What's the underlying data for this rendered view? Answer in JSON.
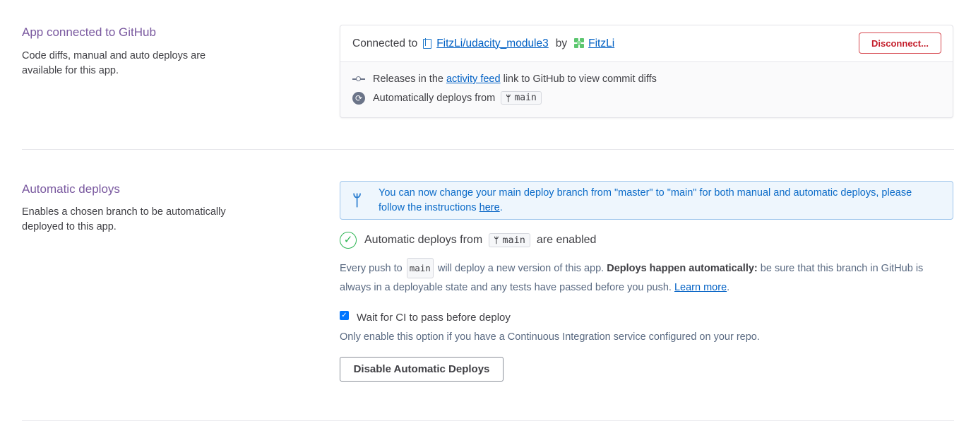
{
  "github_section": {
    "title": "App connected to GitHub",
    "description": "Code diffs, manual and auto deploys are available for this app.",
    "connected_to_label": "Connected to",
    "repo_name": "FitzLi/udacity_module3",
    "by_label": "by",
    "user_name": "FitzLi",
    "disconnect_label": "Disconnect...",
    "releases_prefix": "Releases in the",
    "activity_feed_link": "activity feed",
    "releases_suffix": "link to GitHub to view commit diffs",
    "auto_deploys_from_label": "Automatically deploys from",
    "branch": "main"
  },
  "auto_deploy_section": {
    "title": "Automatic deploys",
    "description": "Enables a chosen branch to be automatically deployed to this app.",
    "banner_text": "You can now change your main deploy branch from \"master\" to \"main\" for both manual and automatic deploys, please follow the instructions",
    "banner_link": "here",
    "banner_end": ".",
    "enabled_prefix": "Automatic deploys from",
    "enabled_branch": "main",
    "enabled_suffix": "are enabled",
    "para_prefix": "Every push to",
    "para_branch": "main",
    "para_middle": "will deploy a new version of this app.",
    "para_bold": "Deploys happen automatically:",
    "para_rest": "be sure that this branch in GitHub is always in a deployable state and any tests have passed before you push.",
    "learn_more": "Learn more",
    "para_end": ".",
    "ci_checkbox_label": "Wait for CI to pass before deploy",
    "ci_checked": true,
    "ci_note": "Only enable this option if you have a Continuous Integration service configured on your repo.",
    "disable_button": "Disable Automatic Deploys"
  },
  "colors": {
    "section_title": "#79589f",
    "link": "#0060c4",
    "danger": "#c41e2b",
    "success": "#2db553",
    "info_bg": "#eef6fd"
  }
}
